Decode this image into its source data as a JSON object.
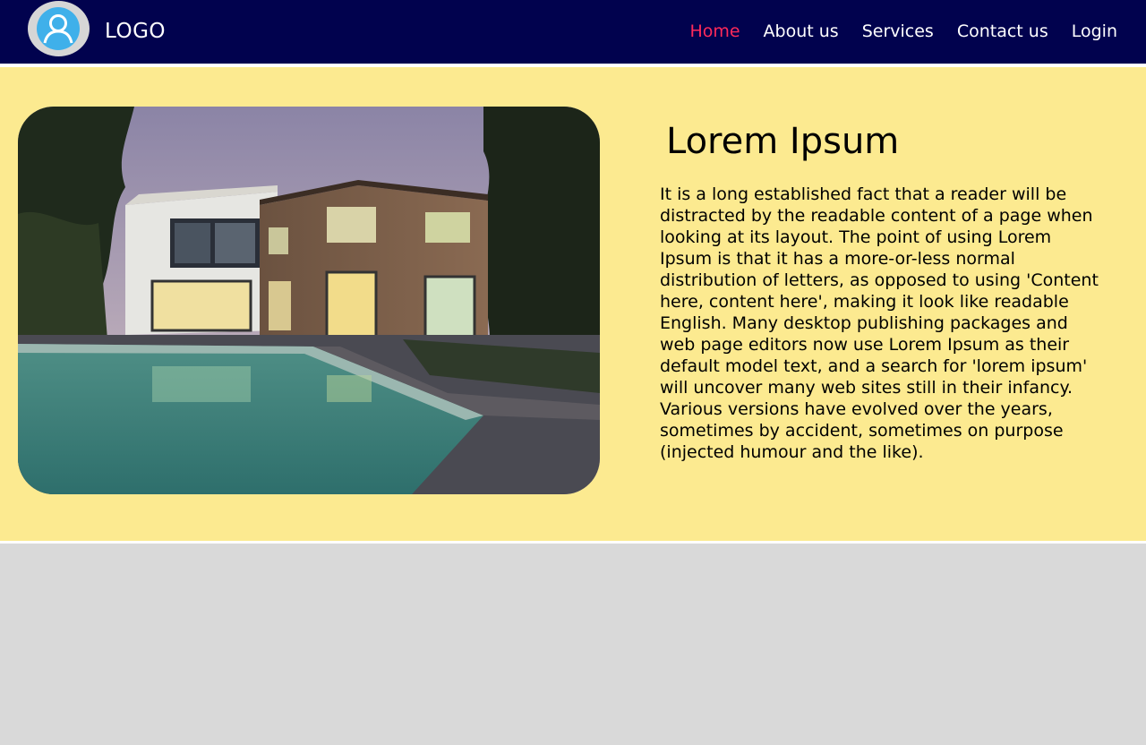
{
  "header": {
    "logo_text": "LOGO",
    "logo_icon": "user-avatar-icon",
    "nav": [
      {
        "label": "Home",
        "active": true
      },
      {
        "label": "About us",
        "active": false
      },
      {
        "label": "Services",
        "active": false
      },
      {
        "label": "Contact us",
        "active": false
      },
      {
        "label": "Login",
        "active": false
      }
    ]
  },
  "hero": {
    "image_subject": "modern-house-with-pool-photo",
    "title": "Lorem Ipsum",
    "text": "It is a long established fact that a reader will be distracted by the readable content of a page when looking at its layout. The point of using Lorem Ipsum is that it has a more-or-less normal distribution of letters, as opposed to using 'Content here, content here', making it look like readable English. Many desktop publishing packages and web page editors now use Lorem Ipsum as their default model text, and a search for 'lorem ipsum' will uncover many web sites still in their infancy. Various versions have evolved over the years, sometimes by accident, sometimes on purpose (injected humour and the like)."
  },
  "colors": {
    "nav_background": "#01024e",
    "nav_active": "#ff2a5a",
    "hero_background": "#fcea90",
    "page_background": "#d9d9d9"
  }
}
